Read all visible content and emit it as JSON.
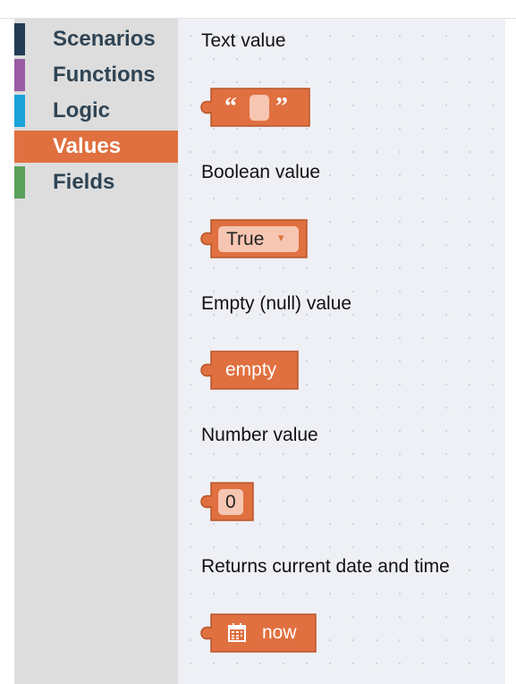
{
  "colors": {
    "accent": "#e07040",
    "block_border": "#b8542a",
    "field_bg": "#f6c6b2"
  },
  "categories": [
    {
      "label": "Scenarios",
      "color": "#243b55",
      "selected": false
    },
    {
      "label": "Functions",
      "color": "#9b5ca6",
      "selected": false
    },
    {
      "label": "Logic",
      "color": "#1aa3d8",
      "selected": false
    },
    {
      "label": "Values",
      "color": "#e07040",
      "selected": true
    },
    {
      "label": "Fields",
      "color": "#5ba15b",
      "selected": false
    }
  ],
  "flyout": {
    "text_value": {
      "label": "Text value",
      "open_quote": "“",
      "close_quote": "”"
    },
    "boolean_value": {
      "label": "Boolean value",
      "value": "True",
      "dropdown": "▾"
    },
    "null_value": {
      "label": "Empty (null) value",
      "text": "empty"
    },
    "number_value": {
      "label": "Number value",
      "value": "0"
    },
    "now_value": {
      "label": "Returns current date and time",
      "icon": "calendar-icon",
      "text": "now"
    }
  }
}
